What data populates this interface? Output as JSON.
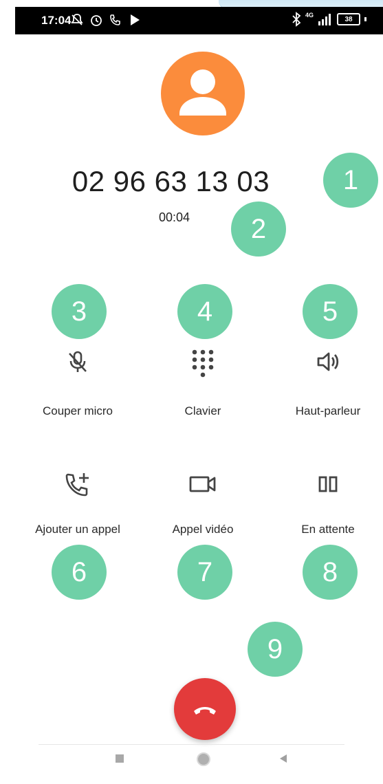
{
  "status_bar": {
    "time": "17:04",
    "battery": "38",
    "network": "4G"
  },
  "call": {
    "number": "02 96 63 13 03",
    "duration": "00:04"
  },
  "actions": [
    {
      "id": "mute",
      "label": "Couper micro",
      "icon": "mic-off-icon"
    },
    {
      "id": "keypad",
      "label": "Clavier",
      "icon": "dialpad-icon"
    },
    {
      "id": "speaker",
      "label": "Haut-parleur",
      "icon": "speaker-icon"
    },
    {
      "id": "add_call",
      "label": "Ajouter un appel",
      "icon": "add-call-icon"
    },
    {
      "id": "video",
      "label": "Appel vidéo",
      "icon": "video-call-icon"
    },
    {
      "id": "hold",
      "label": "En attente",
      "icon": "pause-icon"
    }
  ],
  "badges": [
    "1",
    "2",
    "3",
    "4",
    "5",
    "6",
    "7",
    "8",
    "9"
  ],
  "colors": {
    "avatar": "#fb8c3c",
    "badge": "#6fd0a7",
    "end_call": "#e33b3b"
  }
}
